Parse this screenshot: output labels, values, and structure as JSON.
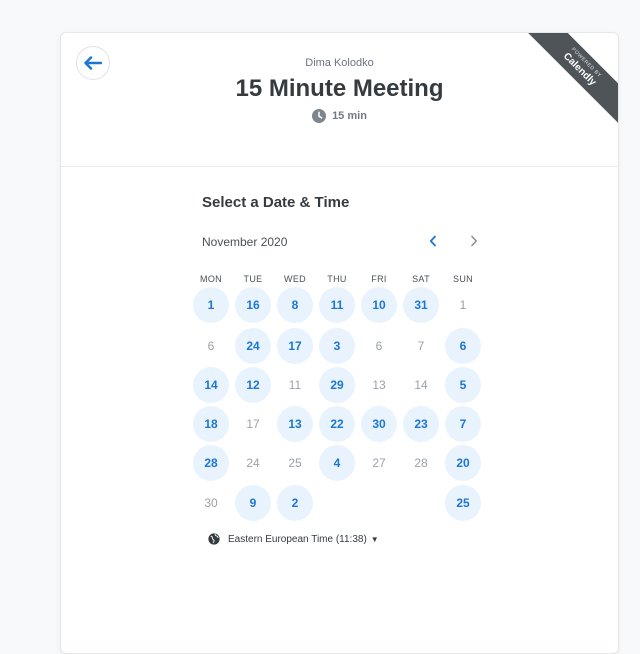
{
  "event": {
    "host_name": "Dima Kolodko",
    "title": "15 Minute Meeting",
    "duration": "15 min"
  },
  "branding": {
    "powered_by": "POWERED BY",
    "brand": "Calendly"
  },
  "scheduler": {
    "section_title": "Select a Date & Time",
    "month_label": "November 2020",
    "weekdays": [
      "MON",
      "TUE",
      "WED",
      "THU",
      "FRI",
      "SAT",
      "SUN"
    ],
    "weeks": [
      [
        {
          "label": "1",
          "available": true
        },
        {
          "label": "16",
          "available": true
        },
        {
          "label": "8",
          "available": true
        },
        {
          "label": "11",
          "available": true
        },
        {
          "label": "10",
          "available": true
        },
        {
          "label": "31",
          "available": true
        },
        {
          "label": "1",
          "available": false
        }
      ],
      [
        {
          "label": "6",
          "available": false
        },
        {
          "label": "24",
          "available": true
        },
        {
          "label": "17",
          "available": true
        },
        {
          "label": "3",
          "available": true
        },
        {
          "label": "6",
          "available": false
        },
        {
          "label": "7",
          "available": false
        },
        {
          "label": "6",
          "available": true
        }
      ],
      [
        {
          "label": "14",
          "available": true
        },
        {
          "label": "12",
          "available": true
        },
        {
          "label": "11",
          "available": false
        },
        {
          "label": "29",
          "available": true
        },
        {
          "label": "13",
          "available": false
        },
        {
          "label": "14",
          "available": false
        },
        {
          "label": "5",
          "available": true
        }
      ],
      [
        {
          "label": "18",
          "available": true
        },
        {
          "label": "17",
          "available": false
        },
        {
          "label": "13",
          "available": true
        },
        {
          "label": "22",
          "available": true
        },
        {
          "label": "30",
          "available": true
        },
        {
          "label": "23",
          "available": true
        },
        {
          "label": "7",
          "available": true
        }
      ],
      [
        {
          "label": "28",
          "available": true
        },
        {
          "label": "24",
          "available": false
        },
        {
          "label": "25",
          "available": false
        },
        {
          "label": "4",
          "available": true
        },
        {
          "label": "27",
          "available": false
        },
        {
          "label": "28",
          "available": false
        },
        {
          "label": "20",
          "available": true
        }
      ],
      [
        {
          "label": "30",
          "available": false
        },
        {
          "label": "9",
          "available": true
        },
        {
          "label": "2",
          "available": true
        },
        null,
        null,
        null,
        {
          "label": "25",
          "available": true
        }
      ]
    ],
    "timezone": "Eastern European Time (11:38)"
  },
  "colors": {
    "accent": "#1c76d2",
    "available_bg": "#e9f3fd",
    "unavailable_text": "#9aa1a9",
    "ribbon": "#4f5459"
  },
  "icons": {
    "back": "arrow-left-icon",
    "duration": "clock-icon",
    "prev": "chevron-left-icon",
    "next": "chevron-right-icon",
    "timezone": "globe-icon",
    "dropdown": "caret-down-icon"
  }
}
